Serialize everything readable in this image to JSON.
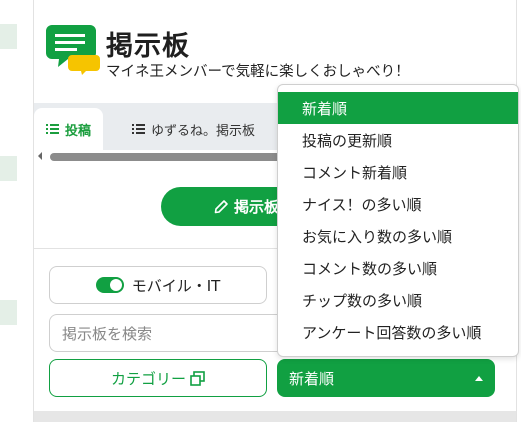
{
  "colors": {
    "accent": "#11a042",
    "logo_yellow": "#f6c400"
  },
  "header": {
    "title": "掲示板",
    "subtitle": "マイネ王メンバーで気軽に楽しくおしゃべり！"
  },
  "tabs": [
    {
      "label": "投稿",
      "icon": "list-icon",
      "active": true
    },
    {
      "label": "ゆずるね。掲示板",
      "icon": "list-icon",
      "active": false
    }
  ],
  "post_button": {
    "label": "掲示板",
    "icon": "pencil-icon"
  },
  "filters": {
    "category_chip": {
      "label": "モバイル・IT",
      "toggle_on": true
    },
    "search": {
      "placeholder": "掲示板を検索"
    },
    "category_button": {
      "label": "カテゴリー",
      "icon": "external-window-icon"
    },
    "sort": {
      "selected": "新着順",
      "icon": "caret-up-icon"
    }
  },
  "sort_options": [
    "新着順",
    "投稿の更新順",
    "コメント新着順",
    "ナイス！の多い順",
    "お気に入り数の多い順",
    "コメント数の多い順",
    "チップ数の多い順",
    "アンケート回答数の多い順"
  ]
}
